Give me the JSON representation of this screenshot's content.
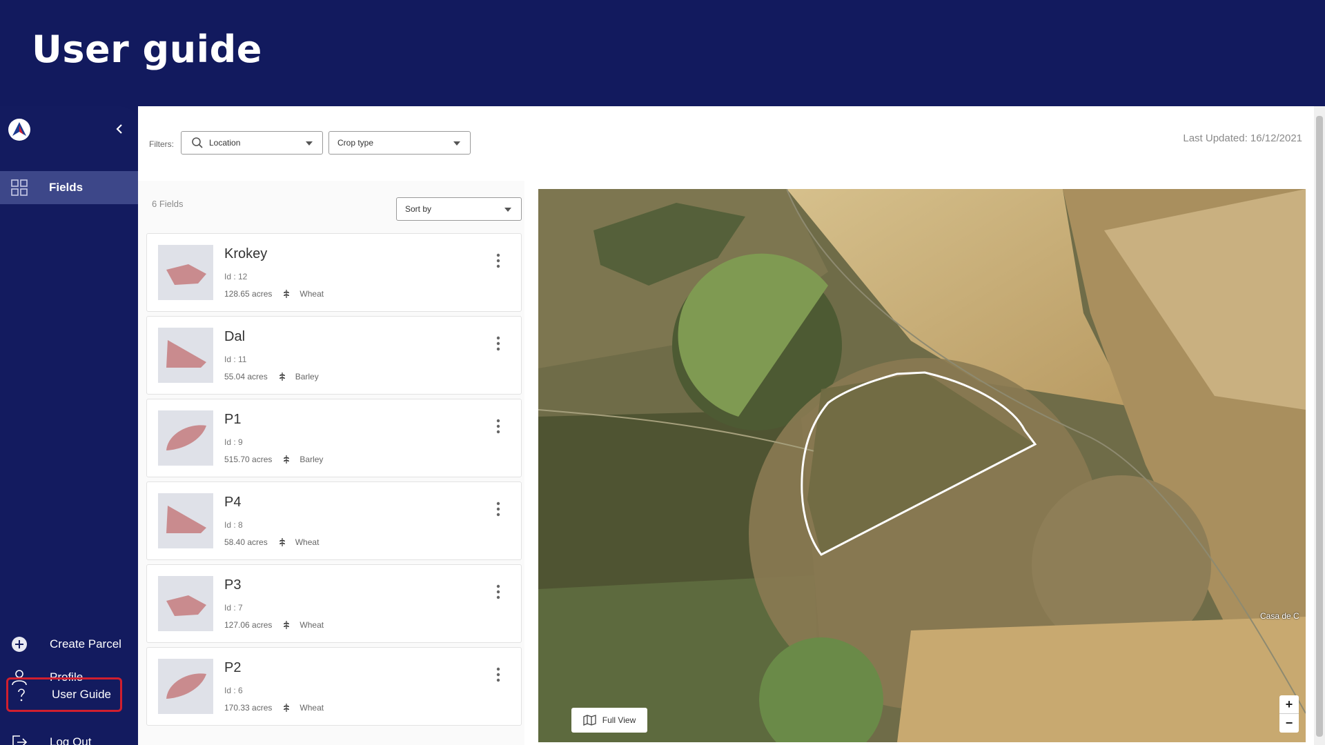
{
  "header": {
    "title": "User guide"
  },
  "sidebar": {
    "nav": [
      {
        "label": "Fields",
        "icon": "grid-icon"
      }
    ],
    "bottom": [
      {
        "label": "Create Parcel",
        "icon": "plus-circle-icon"
      },
      {
        "label": "Profile",
        "icon": "user-icon"
      },
      {
        "label": "User Guide",
        "icon": "help-icon"
      },
      {
        "label": "Log Out",
        "icon": "logout-icon"
      }
    ],
    "highlight_color": "#d11f2e",
    "active_bg": "#3d4789"
  },
  "filters": {
    "label": "Filters:",
    "location": "Location",
    "crop": "Crop type"
  },
  "last_updated": "Last Updated: 16/12/2021",
  "list": {
    "count": "6 Fields",
    "sort_label": "Sort by",
    "fields": [
      {
        "name": "Krokey",
        "id": "Id : 12",
        "area": "128.65 acres",
        "crop": "Wheat",
        "shape": "poly"
      },
      {
        "name": "Dal",
        "id": "Id : 11",
        "area": "55.04 acres",
        "crop": "Barley",
        "shape": "tri"
      },
      {
        "name": "P1",
        "id": "Id : 9",
        "area": "515.70 acres",
        "crop": "Barley",
        "shape": "half"
      },
      {
        "name": "P4",
        "id": "Id : 8",
        "area": "58.40 acres",
        "crop": "Wheat",
        "shape": "tri"
      },
      {
        "name": "P3",
        "id": "Id : 7",
        "area": "127.06 acres",
        "crop": "Wheat",
        "shape": "poly"
      },
      {
        "name": "P2",
        "id": "Id : 6",
        "area": "170.33 acres",
        "crop": "Wheat",
        "shape": "half"
      }
    ]
  },
  "map": {
    "full_view": "Full View",
    "zoom_in": "+",
    "zoom_out": "−",
    "place_label": "Casa de C"
  },
  "colors": {
    "brand": "#121a5e",
    "parcel_fill": "#c98b8e",
    "thumb_bg": "#dfe1e8"
  }
}
